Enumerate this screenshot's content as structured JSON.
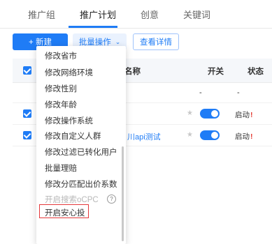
{
  "tabs": [
    "推广组",
    "推广计划",
    "创意",
    "关键词"
  ],
  "toolbar": {
    "new_label": "+ 新建",
    "batch_label": "批量操作",
    "detail_label": "查看详情"
  },
  "table": {
    "headers": {
      "name": "名称",
      "switch": "开关",
      "status": "状态"
    },
    "rows": [
      {
        "switch_text": "-",
        "status_text": "-"
      },
      {
        "status": "启动"
      },
      {
        "name_fragment": "川api测试",
        "status": "启动"
      }
    ]
  },
  "dropdown": {
    "items": [
      "修改省市",
      "修改网络环境",
      "修改性别",
      "修改年龄",
      "修改操作系统",
      "修改自定义人群",
      "修改过滤已转化用户",
      "批量理赔",
      "修改分匹配出价系数",
      "开启搜索oCPC",
      "开启安心投"
    ],
    "help_glyph": "?"
  },
  "colors": {
    "accent": "#1f7cf6",
    "alert": "#e43b32"
  }
}
